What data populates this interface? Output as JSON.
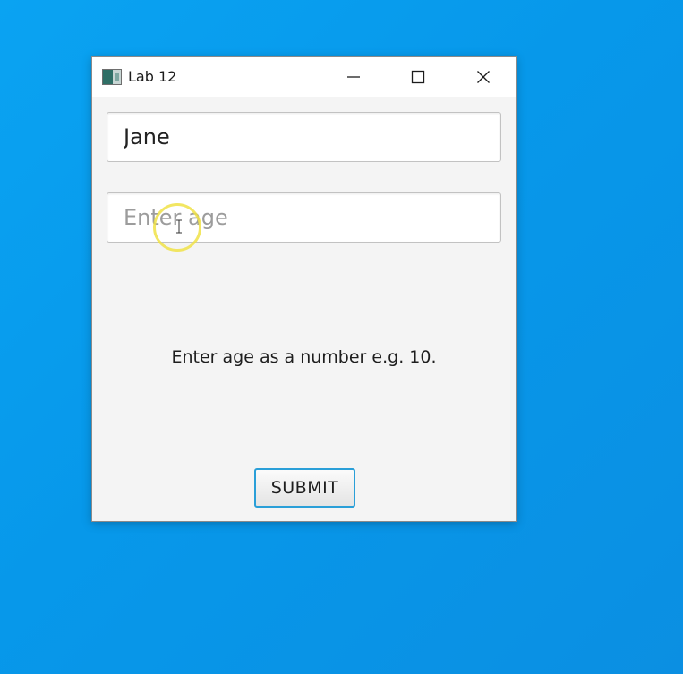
{
  "window": {
    "title": "Lab 12",
    "controls": {
      "minimize_icon": "minimize-icon",
      "maximize_icon": "maximize-icon",
      "close_icon": "close-icon"
    }
  },
  "form": {
    "name_value": "Jane",
    "age_value": "",
    "age_placeholder": "Enter age",
    "hint_text": "Enter age as a number e.g. 10.",
    "submit_label": "SUBMIT"
  },
  "colors": {
    "desktop_background": "#0aa3f2",
    "focus_border": "#2a9fd8",
    "cursor_highlight": "#f0e246"
  }
}
